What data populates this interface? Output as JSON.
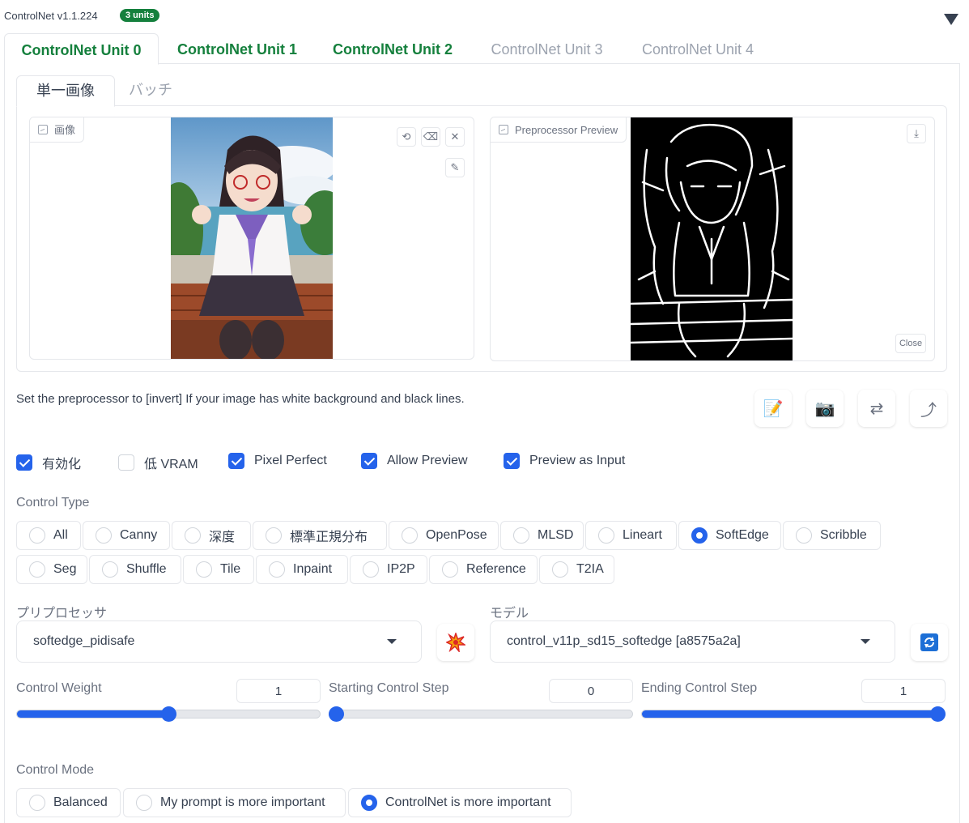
{
  "header": {
    "title": "ControlNet v1.1.224",
    "badge": "3 units"
  },
  "unit_tabs": [
    "ControlNet Unit 0",
    "ControlNet Unit 1",
    "ControlNet Unit 2",
    "ControlNet Unit 3",
    "ControlNet Unit 4"
  ],
  "image_tabs": [
    "単一画像",
    "バッチ"
  ],
  "input_image": {
    "label": "画像"
  },
  "preview_image": {
    "label": "Preprocessor Preview",
    "close_label": "Close"
  },
  "hint": "Set the preprocessor to [invert] If your image has white background and black lines.",
  "checkboxes": [
    {
      "label": "有効化",
      "checked": true
    },
    {
      "label": "低 VRAM",
      "checked": false
    },
    {
      "label": "Pixel Perfect",
      "checked": true
    },
    {
      "label": "Allow Preview",
      "checked": true
    },
    {
      "label": "Preview as Input",
      "checked": true
    }
  ],
  "control_type": {
    "label": "Control Type",
    "selected": "SoftEdge",
    "options": [
      "All",
      "Canny",
      "深度",
      "標準正規分布",
      "OpenPose",
      "MLSD",
      "Lineart",
      "SoftEdge",
      "Scribble",
      "Seg",
      "Shuffle",
      "Tile",
      "Inpaint",
      "IP2P",
      "Reference",
      "T2IA"
    ]
  },
  "preprocessor": {
    "label": "プリプロセッサ",
    "value": "softedge_pidisafe"
  },
  "model": {
    "label": "モデル",
    "value": "control_v11p_sd15_softedge [a8575a2a]"
  },
  "sliders": [
    {
      "label": "Control Weight",
      "value": "1",
      "level": 0.5
    },
    {
      "label": "Starting Control Step",
      "value": "0",
      "level": 0.0
    },
    {
      "label": "Ending Control Step",
      "value": "1",
      "level": 1.0
    }
  ],
  "control_mode": {
    "label": "Control Mode",
    "selected": "ControlNet is more important",
    "options": [
      "Balanced",
      "My prompt is more important",
      "ControlNet is more important"
    ]
  },
  "colors": {
    "accent": "#2563eb",
    "active_tab": "#15803d",
    "inactive_tab": "#9ca3af"
  }
}
